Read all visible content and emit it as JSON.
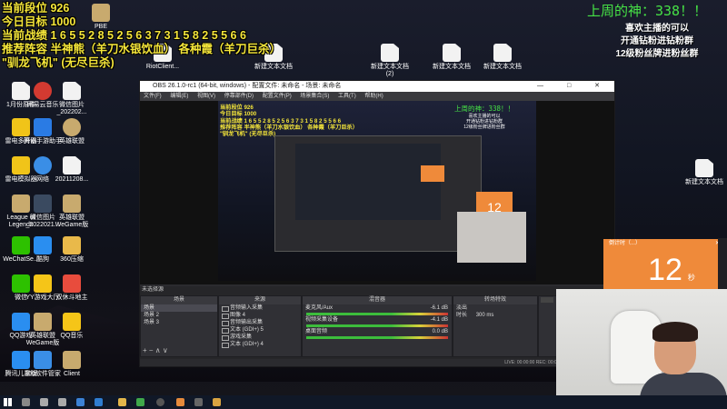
{
  "overlay_left": {
    "lines": [
      "当前段位 926",
      "今日目标 1000",
      "当前战绩 1 6 5 5 2 8 5 2 5 6 3 7 3 1 5 8 2 5 5 6 6",
      "推荐阵容 半神熊（羊刀水银饮血） 各种霞（羊刀巨杀）",
      "\"驯龙飞机\" (无尽巨杀)"
    ]
  },
  "overlay_right": {
    "god_text": "上周的神：338！！",
    "lines": [
      "喜欢主播的可以",
      "开通钻粉进钻粉群",
      "12级粉丝牌进粉丝群"
    ]
  },
  "desktop_icons": [
    {
      "label": "1月份原件",
      "type": "doc"
    },
    {
      "label": "网易云音乐",
      "type": "app",
      "color": "#d33a31"
    },
    {
      "label": "微信图片_202202...",
      "type": "doc"
    },
    {
      "label": "雷电多开器",
      "type": "app",
      "color": "#f0c419"
    },
    {
      "label": "腾讯手游助手",
      "type": "app",
      "color": "#2a7be4"
    },
    {
      "label": "英雄联盟",
      "type": "app",
      "color": "#c8aa6e"
    },
    {
      "label": "雷电模拟器",
      "type": "app",
      "color": "#f0c419"
    },
    {
      "label": "网络",
      "type": "app",
      "color": "#3a8ee6"
    },
    {
      "label": "20211208...",
      "type": "doc"
    },
    {
      "label": "League of Legends",
      "type": "app",
      "color": "#c8aa6e"
    },
    {
      "label": "微信图片_2022021...",
      "type": "app",
      "color": "#3a4a60"
    },
    {
      "label": "英雄联盟WeGame版",
      "type": "app",
      "color": "#c8aa6e"
    },
    {
      "label": "WeChatSe...",
      "type": "app",
      "color": "#2dc100"
    },
    {
      "label": "酷狗",
      "type": "app",
      "color": "#2a8ef0"
    },
    {
      "label": "360压缩",
      "type": "folder"
    },
    {
      "label": "微信",
      "type": "app",
      "color": "#2dc100"
    },
    {
      "label": "YY游戏大厅",
      "type": "app",
      "color": "#f5c518"
    },
    {
      "label": "双休斗地主",
      "type": "app",
      "color": "#e84c3d"
    },
    {
      "label": "QQ游戏",
      "type": "app",
      "color": "#2a8ef0"
    },
    {
      "label": "英雄联盟WeGame版",
      "type": "app",
      "color": "#c8aa6e"
    },
    {
      "label": "QQ音乐",
      "type": "app",
      "color": "#f5c518"
    },
    {
      "label": "腾讯儿童版",
      "type": "app",
      "color": "#2a8ef0"
    },
    {
      "label": "360软件管家",
      "type": "app",
      "color": "#3a8ee6"
    },
    {
      "label": "Client",
      "type": "app",
      "color": "#c8aa6e"
    },
    {
      "label": "PBE",
      "type": "app",
      "color": "#c8aa6e"
    },
    {
      "label": "RiotClient...",
      "type": "doc"
    },
    {
      "label": "新建文本文档",
      "type": "doc"
    },
    {
      "label": "新建文本文档(2)",
      "type": "doc"
    },
    {
      "label": "新建文本文档",
      "type": "doc"
    },
    {
      "label": "新建文本文档",
      "type": "doc"
    },
    {
      "label": "新建文本文档",
      "type": "doc"
    }
  ],
  "obs": {
    "title": "OBS 26.1.0-rc1 (64-bit, windows) - 配置文件: 未命名 - 场景: 未命名",
    "window_buttons": "— □ ✕",
    "menu": [
      "文件(F)",
      "编辑(E)",
      "视图(V)",
      "停靠部件(D)",
      "配置文件(P)",
      "场景集合(S)",
      "工具(T)",
      "帮助(H)"
    ],
    "source_label": "未选择源",
    "scenes_header": "场景",
    "scenes": [
      "场景",
      "场景 2",
      "场景 3"
    ],
    "sources_header": "来源",
    "sources": [
      "音频输入采集",
      "图像 4",
      "音频输出采集",
      "文本 (GDI+) 5",
      "游戏采集",
      "文本 (GDI+) 4"
    ],
    "mixer_header": "混音器",
    "mixer": [
      {
        "name": "麦克风/Aux",
        "db": "-6.1 dB"
      },
      {
        "name": "视频采集设备",
        "db": "-4.1 dB"
      },
      {
        "name": "桌面音频",
        "db": "0.0 dB"
      }
    ],
    "transition_header": "转场特效",
    "transition_value": "淡出",
    "duration_label": "时长",
    "duration_value": "300 ms",
    "statusbar": "LIVE: 00:00:00   REC: 00:00:00   CPU: 5.5%, 60.00 fps"
  },
  "timer": {
    "header": "倒计时（...）",
    "value": "12",
    "unit": "秒",
    "close": "✕"
  },
  "colors": {
    "overlay_yellow": "#f5e63a",
    "god_green": "#46e246",
    "timer_orange": "#ef8a3a"
  }
}
